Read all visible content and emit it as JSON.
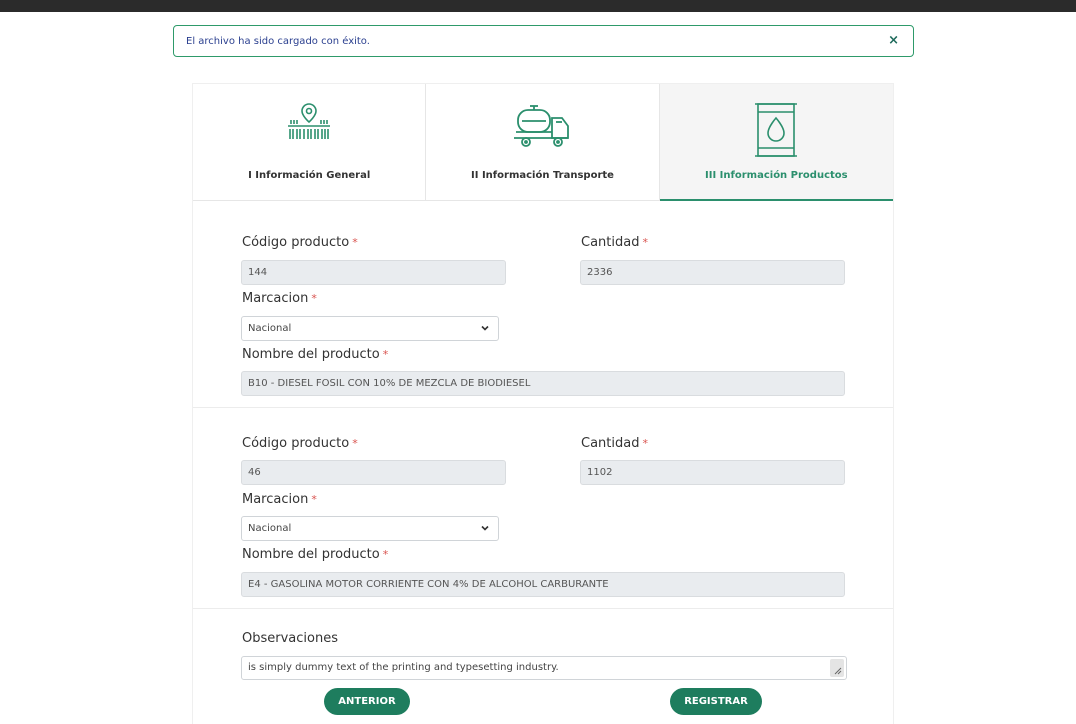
{
  "alert": {
    "message": "El archivo ha sido cargado con éxito.",
    "close": "×"
  },
  "tabs": [
    {
      "label": "I Información General",
      "icon": "location-barcode-icon"
    },
    {
      "label": "II Información Transporte",
      "icon": "tank-truck-icon"
    },
    {
      "label": "III Información Productos",
      "icon": "oil-barrel-icon"
    }
  ],
  "products": [
    {
      "codigo_label": "Código producto",
      "codigo_value": "144",
      "cantidad_label": "Cantidad",
      "cantidad_value": "2336",
      "marcacion_label": "Marcacion",
      "marcacion_value": "Nacional",
      "nombre_label": "Nombre del producto",
      "nombre_value": "B10 - DIESEL FOSIL CON 10% DE MEZCLA DE BIODIESEL"
    },
    {
      "codigo_label": "Código producto",
      "codigo_value": "46",
      "cantidad_label": "Cantidad",
      "cantidad_value": "1102",
      "marcacion_label": "Marcacion",
      "marcacion_value": "Nacional",
      "nombre_label": "Nombre del producto",
      "nombre_value": "E4 - GASOLINA MOTOR CORRIENTE CON 4% DE ALCOHOL CARBURANTE"
    }
  ],
  "required_marker": "*",
  "observaciones": {
    "label": "Observaciones",
    "value": "is simply dummy text of the printing and typesetting industry."
  },
  "buttons": {
    "anterior": "ANTERIOR",
    "registrar": "REGISTRAR"
  },
  "colors": {
    "accent": "#2b8f6d",
    "button": "#1e7d5e",
    "required": "#d9534f",
    "alert_text": "#2a3f8f"
  }
}
